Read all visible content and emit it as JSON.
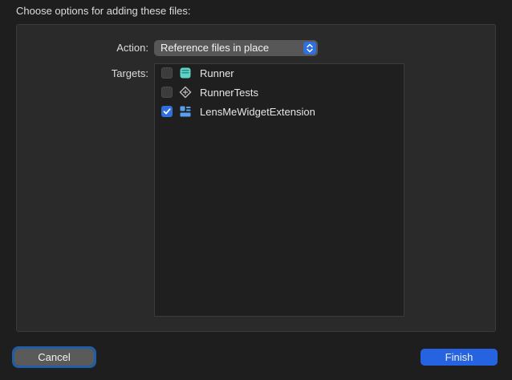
{
  "dialog": {
    "heading": "Choose options for adding these files:"
  },
  "action": {
    "label": "Action:",
    "selected": "Reference files in place"
  },
  "targets": {
    "label": "Targets:",
    "items": [
      {
        "label": "Runner",
        "checked": false,
        "icon": "app-target-icon"
      },
      {
        "label": "RunnerTests",
        "checked": false,
        "icon": "test-target-icon"
      },
      {
        "label": "LensMeWidgetExtension",
        "checked": true,
        "icon": "widget-extension-icon"
      }
    ]
  },
  "buttons": {
    "cancel_label": "Cancel",
    "finish_label": "Finish"
  },
  "colors": {
    "accent": "#2f6fe0",
    "background": "#1e1e1e",
    "panel": "#2a2a2a"
  }
}
